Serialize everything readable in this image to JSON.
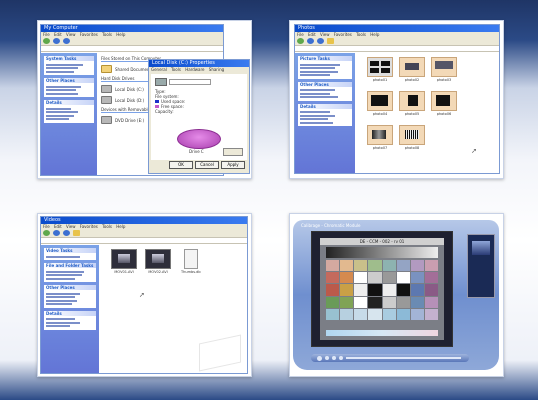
{
  "panel1": {
    "title": "My Computer",
    "menu": [
      "File",
      "Edit",
      "View",
      "Favorites",
      "Tools",
      "Help"
    ],
    "tasks": [
      "System Tasks",
      "Other Places",
      "Details"
    ],
    "headers": [
      "Files Stored on This Computer",
      "Hard Disk Drives",
      "Devices with Removable Storage"
    ],
    "devices": [
      "Shared Documents",
      "Local Disk (C:)",
      "Local Disk (D:)",
      "DVD Drive (E:)"
    ],
    "dialog": {
      "title": "Local Disk (C:) Properties",
      "tabs": [
        "General",
        "Tools",
        "Hardware",
        "Sharing"
      ],
      "rows": [
        "Type:",
        "File system:",
        "Used space:",
        "Free space:",
        "Capacity:"
      ],
      "drive": "Drive C",
      "buttons": [
        "OK",
        "Cancel",
        "Apply"
      ]
    }
  },
  "panel2": {
    "title": "Photos",
    "menu": [
      "File",
      "Edit",
      "View",
      "Favorites",
      "Tools",
      "Help"
    ],
    "tasks": [
      "Picture Tasks",
      "Other Places",
      "Details"
    ],
    "tiles": [
      "photo01",
      "photo02",
      "photo03",
      "photo04",
      "photo05",
      "photo06",
      "photo07",
      "photo08"
    ]
  },
  "panel3": {
    "title": "Videos",
    "menu": [
      "File",
      "Edit",
      "View",
      "Favorites",
      "Tools",
      "Help"
    ],
    "tasks": [
      "Video Tasks",
      "File and Folder Tasks",
      "Other Places",
      "Details"
    ],
    "files": [
      "MOV01.AVI",
      "MOV02.AVI",
      "Thumbs.db"
    ]
  },
  "panel4": {
    "title": "Calibrage - Chromatic Module",
    "header_text": "DE - CCM - 002 - rv 01"
  },
  "colors": {
    "xp_blue": "#0a4bcc",
    "task_pane": "#6375d6",
    "photo_bg": "#f3d9b7"
  }
}
